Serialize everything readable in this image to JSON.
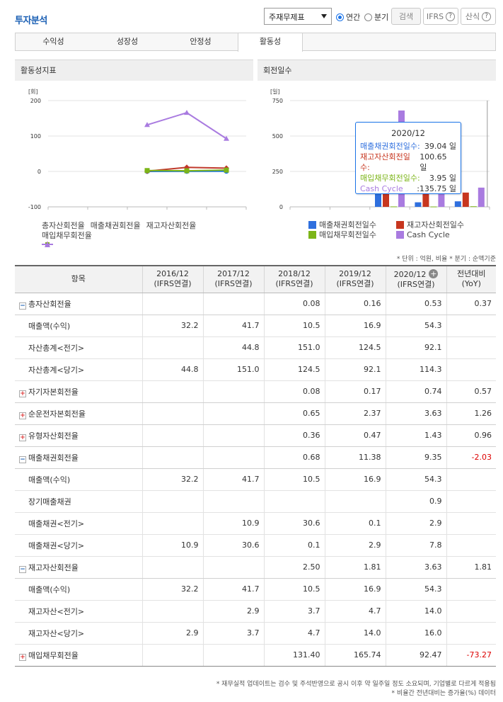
{
  "header": {
    "title": "투자분석",
    "select_value": "주재무제표",
    "radio_annual": "연간",
    "radio_quarter": "분기",
    "search_label": "검색",
    "ifrs_label": "IFRS",
    "formula_label": "산식",
    "help_glyph": "?"
  },
  "tabs": [
    "수익성",
    "성장성",
    "안정성",
    "활동성"
  ],
  "left_chart": {
    "panel_title": "활동성지표",
    "unit": "[회]",
    "legend": [
      "총자산회전율",
      "매출채권회전율",
      "재고자산회전율",
      "매입채무회전율"
    ]
  },
  "right_chart": {
    "panel_title": "회전일수",
    "unit": "[일]",
    "legend": [
      "매출채권회전일수",
      "재고자산회전일수",
      "매입채무회전일수",
      "Cash Cycle"
    ],
    "tooltip": {
      "title": "2020/12",
      "rows": [
        {
          "label": "매출채권회전일수:",
          "value": "39.04 일"
        },
        {
          "label": "재고자산회전일수:",
          "value": "100.65 일"
        },
        {
          "label": "매입채무회전일수:",
          "value": "3.95 일"
        },
        {
          "label": "Cash Cycle",
          "value": ":135.75 일"
        }
      ]
    }
  },
  "chart_data": [
    {
      "type": "line",
      "categories": [
        "2016/12",
        "2017/12",
        "2018/12",
        "2019/12",
        "2020/12"
      ],
      "ylabel": "[회]",
      "ylim": [
        -100,
        200
      ],
      "yticks": [
        -100,
        0,
        100,
        200
      ],
      "series": [
        {
          "name": "총자산회전율",
          "color": "#1a73e8",
          "values": [
            null,
            null,
            0.08,
            0.16,
            0.53
          ]
        },
        {
          "name": "매출채권회전율",
          "color": "#c0392b",
          "values": [
            null,
            null,
            0.68,
            11.38,
            9.35
          ]
        },
        {
          "name": "재고자산회전율",
          "color": "#7cb518",
          "values": [
            null,
            null,
            2.5,
            1.81,
            3.63
          ]
        },
        {
          "name": "매입채무회전율",
          "color": "#a97be0",
          "values": [
            null,
            null,
            131.4,
            165.74,
            92.47
          ]
        }
      ]
    },
    {
      "type": "bar",
      "categories": [
        "2016/12",
        "2017/12",
        "2018/12",
        "2019/12",
        "2020/12"
      ],
      "ylabel": "[일]",
      "ylim": [
        0,
        750
      ],
      "yticks": [
        0,
        250,
        500,
        750
      ],
      "series": [
        {
          "name": "매출채권회전일수",
          "color": "#2f6fde",
          "values": [
            null,
            null,
            536.8,
            32.1,
            39.04
          ]
        },
        {
          "name": "재고자산회전일수",
          "color": "#c7361f",
          "values": [
            null,
            null,
            146.0,
            201.7,
            100.65
          ]
        },
        {
          "name": "매입채무회전일수",
          "color": "#7cb518",
          "values": [
            null,
            null,
            2.8,
            2.2,
            3.95
          ]
        },
        {
          "name": "Cash Cycle",
          "color": "#a97be0",
          "values": [
            null,
            null,
            680.0,
            231.6,
            135.75
          ]
        }
      ]
    }
  ],
  "notes_top": "* 단위 : 억원, 비율   * 분기 : 순액기준",
  "table": {
    "headers": [
      {
        "l1": "항목",
        "l2": ""
      },
      {
        "l1": "2016/12",
        "l2": "(IFRS연결)"
      },
      {
        "l1": "2017/12",
        "l2": "(IFRS연결)"
      },
      {
        "l1": "2018/12",
        "l2": "(IFRS연결)"
      },
      {
        "l1": "2019/12",
        "l2": "(IFRS연결)"
      },
      {
        "l1": "2020/12",
        "l2": "(IFRS연결)"
      },
      {
        "l1": "전년대비",
        "l2": "(YoY)"
      }
    ],
    "rows": [
      {
        "kind": "grp",
        "toggle": "minus",
        "label": "총자산회전율",
        "cells": [
          "",
          "",
          "0.08",
          "0.16",
          "0.53",
          "0.37"
        ]
      },
      {
        "kind": "child",
        "label": "매출액(수익)",
        "cells": [
          "32.2",
          "41.7",
          "10.5",
          "16.9",
          "54.3",
          ""
        ]
      },
      {
        "kind": "child",
        "label": "자산총계<전기>",
        "cells": [
          "",
          "44.8",
          "151.0",
          "124.5",
          "92.1",
          ""
        ]
      },
      {
        "kind": "child",
        "label": "자산총계<당기>",
        "cells": [
          "44.8",
          "151.0",
          "124.5",
          "92.1",
          "114.3",
          ""
        ]
      },
      {
        "kind": "grp",
        "toggle": "plus",
        "label": "자기자본회전율",
        "cells": [
          "",
          "",
          "0.08",
          "0.17",
          "0.74",
          "0.57"
        ]
      },
      {
        "kind": "grp",
        "toggle": "plus",
        "label": "순운전자본회전율",
        "cells": [
          "",
          "",
          "0.65",
          "2.37",
          "3.63",
          "1.26"
        ]
      },
      {
        "kind": "grp",
        "toggle": "plus",
        "label": "유형자산회전율",
        "cells": [
          "",
          "",
          "0.36",
          "0.47",
          "1.43",
          "0.96"
        ]
      },
      {
        "kind": "grp",
        "toggle": "minus",
        "label": "매출채권회전율",
        "cells": [
          "",
          "",
          "0.68",
          "11.38",
          "9.35",
          "-2.03"
        ]
      },
      {
        "kind": "child",
        "label": "매출액(수익)",
        "cells": [
          "32.2",
          "41.7",
          "10.5",
          "16.9",
          "54.3",
          ""
        ]
      },
      {
        "kind": "child",
        "label": "장기매출채권",
        "cells": [
          "",
          "",
          "",
          "",
          "0.9",
          ""
        ]
      },
      {
        "kind": "child",
        "label": "매출채권<전기>",
        "cells": [
          "",
          "10.9",
          "30.6",
          "0.1",
          "2.9",
          ""
        ]
      },
      {
        "kind": "child",
        "label": "매출채권<당기>",
        "cells": [
          "10.9",
          "30.6",
          "0.1",
          "2.9",
          "7.8",
          ""
        ]
      },
      {
        "kind": "grp",
        "toggle": "minus",
        "label": "재고자산회전율",
        "cells": [
          "",
          "",
          "2.50",
          "1.81",
          "3.63",
          "1.81"
        ]
      },
      {
        "kind": "child",
        "label": "매출액(수익)",
        "cells": [
          "32.2",
          "41.7",
          "10.5",
          "16.9",
          "54.3",
          ""
        ]
      },
      {
        "kind": "child",
        "label": "재고자산<전기>",
        "cells": [
          "",
          "2.9",
          "3.7",
          "4.7",
          "14.0",
          ""
        ]
      },
      {
        "kind": "child",
        "label": "재고자산<당기>",
        "cells": [
          "2.9",
          "3.7",
          "4.7",
          "14.0",
          "16.0",
          ""
        ]
      },
      {
        "kind": "grp",
        "toggle": "plus",
        "label": "매입채무회전율",
        "cells": [
          "",
          "",
          "131.40",
          "165.74",
          "92.47",
          "-73.27"
        ]
      }
    ]
  },
  "footnotes": [
    "* 재무실적 업데이트는 검수 및 주석반영으로 공시 이후 약 일주일 정도 소요되며, 기업별로 다르게 적용됨",
    "* 비율간 전년대비는 증가율(%) 데이터"
  ]
}
